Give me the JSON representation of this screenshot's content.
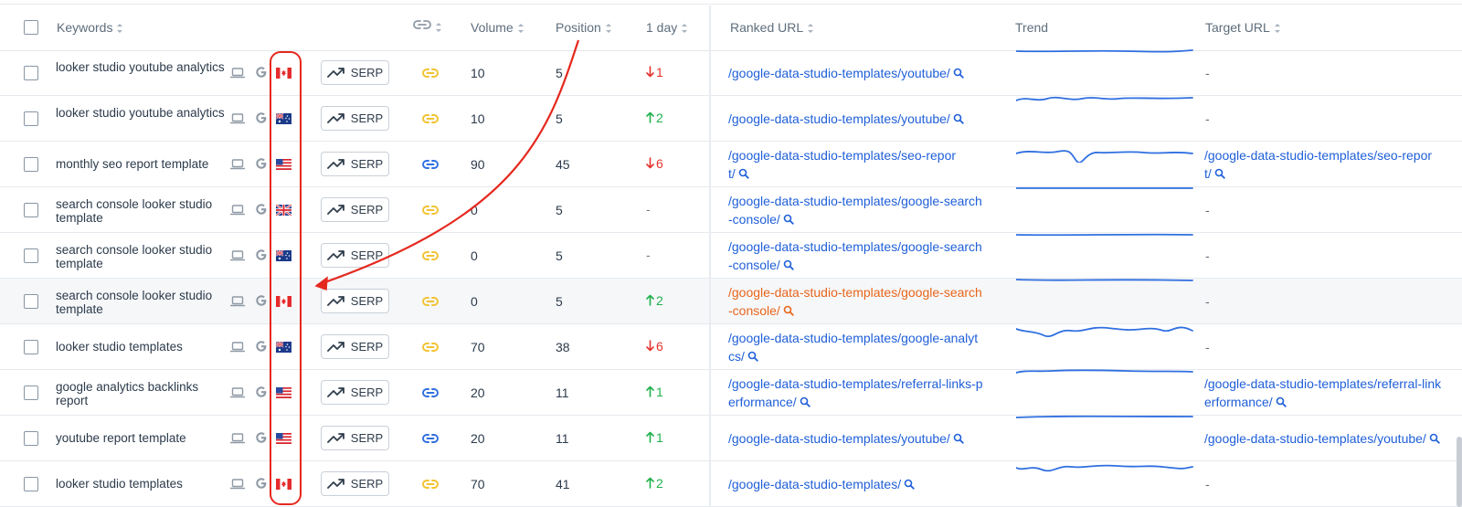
{
  "header": {
    "keywords": "Keywords",
    "volume": "Volume",
    "position": "Position",
    "one_day": "1 day",
    "ranked_url": "Ranked URL",
    "trend": "Trend",
    "target_url": "Target URL"
  },
  "serp_label": "SERP",
  "colors": {
    "link_blue": "#1f5fd8",
    "link_orange": "#e8651a",
    "up_green": "#1fb14b",
    "down_red": "#e5322d",
    "annotation_red": "#e5281e",
    "link_icon_yellow": "#f2c230",
    "link_icon_blue": "#2f6fe0"
  },
  "rows": [
    {
      "keyword": "looker studio youtube analytics",
      "country": "CA",
      "link_icon": "yellow",
      "volume": "10",
      "position": "5",
      "change": "1",
      "direction": "down",
      "ranked_url_1": "/google-data-studio-templates/youtube/",
      "ranked_url_2": "",
      "target_url_1": "-",
      "target_url_2": ""
    },
    {
      "keyword": "looker studio youtube analytics",
      "country": "AU",
      "link_icon": "yellow",
      "volume": "10",
      "position": "5",
      "change": "2",
      "direction": "up",
      "ranked_url_1": "/google-data-studio-templates/youtube/",
      "ranked_url_2": "",
      "target_url_1": "-",
      "target_url_2": ""
    },
    {
      "keyword": "monthly seo report template",
      "country": "US",
      "link_icon": "blue",
      "volume": "90",
      "position": "45",
      "change": "6",
      "direction": "down",
      "ranked_url_1": "/google-data-studio-templates/seo-repor",
      "ranked_url_2": "t/",
      "target_url_1": "/google-data-studio-templates/seo-repor",
      "target_url_2": "t/"
    },
    {
      "keyword": "search console looker studio template",
      "country": "UK",
      "link_icon": "yellow",
      "volume": "0",
      "position": "5",
      "change": "-",
      "direction": "none",
      "ranked_url_1": "/google-data-studio-templates/google-search",
      "ranked_url_2": "-console/",
      "target_url_1": "-",
      "target_url_2": ""
    },
    {
      "keyword": "search console looker studio template",
      "country": "AU",
      "link_icon": "yellow",
      "volume": "0",
      "position": "5",
      "change": "-",
      "direction": "none",
      "ranked_url_1": "/google-data-studio-templates/google-search",
      "ranked_url_2": "-console/",
      "target_url_1": "-",
      "target_url_2": ""
    },
    {
      "keyword": "search console looker studio template",
      "country": "CA",
      "link_icon": "yellow",
      "volume": "0",
      "position": "5",
      "change": "2",
      "direction": "up",
      "ranked_url_1": "/google-data-studio-templates/google-search",
      "ranked_url_2": "-console/",
      "target_url_1": "-",
      "target_url_2": "",
      "highlight": true
    },
    {
      "keyword": "looker studio templates",
      "country": "AU",
      "link_icon": "yellow",
      "volume": "70",
      "position": "38",
      "change": "6",
      "direction": "down",
      "ranked_url_1": "/google-data-studio-templates/google-analyt",
      "ranked_url_2": "cs/",
      "target_url_1": "-",
      "target_url_2": ""
    },
    {
      "keyword": "google analytics backlinks report",
      "country": "US",
      "link_icon": "blue",
      "volume": "20",
      "position": "11",
      "change": "1",
      "direction": "up",
      "ranked_url_1": "/google-data-studio-templates/referral-links-p",
      "ranked_url_2": "erformance/",
      "target_url_1": "/google-data-studio-templates/referral-link",
      "target_url_2": "erformance/"
    },
    {
      "keyword": "youtube report template",
      "country": "US",
      "link_icon": "blue",
      "volume": "20",
      "position": "11",
      "change": "1",
      "direction": "up",
      "ranked_url_1": "/google-data-studio-templates/youtube/",
      "ranked_url_2": "",
      "target_url_1": "/google-data-studio-templates/youtube/",
      "target_url_2": ""
    },
    {
      "keyword": "looker studio templates",
      "country": "CA",
      "link_icon": "yellow",
      "volume": "70",
      "position": "41",
      "change": "2",
      "direction": "up",
      "ranked_url_1": "/google-data-studio-templates/",
      "ranked_url_2": "",
      "target_url_1": "-",
      "target_url_2": ""
    }
  ]
}
